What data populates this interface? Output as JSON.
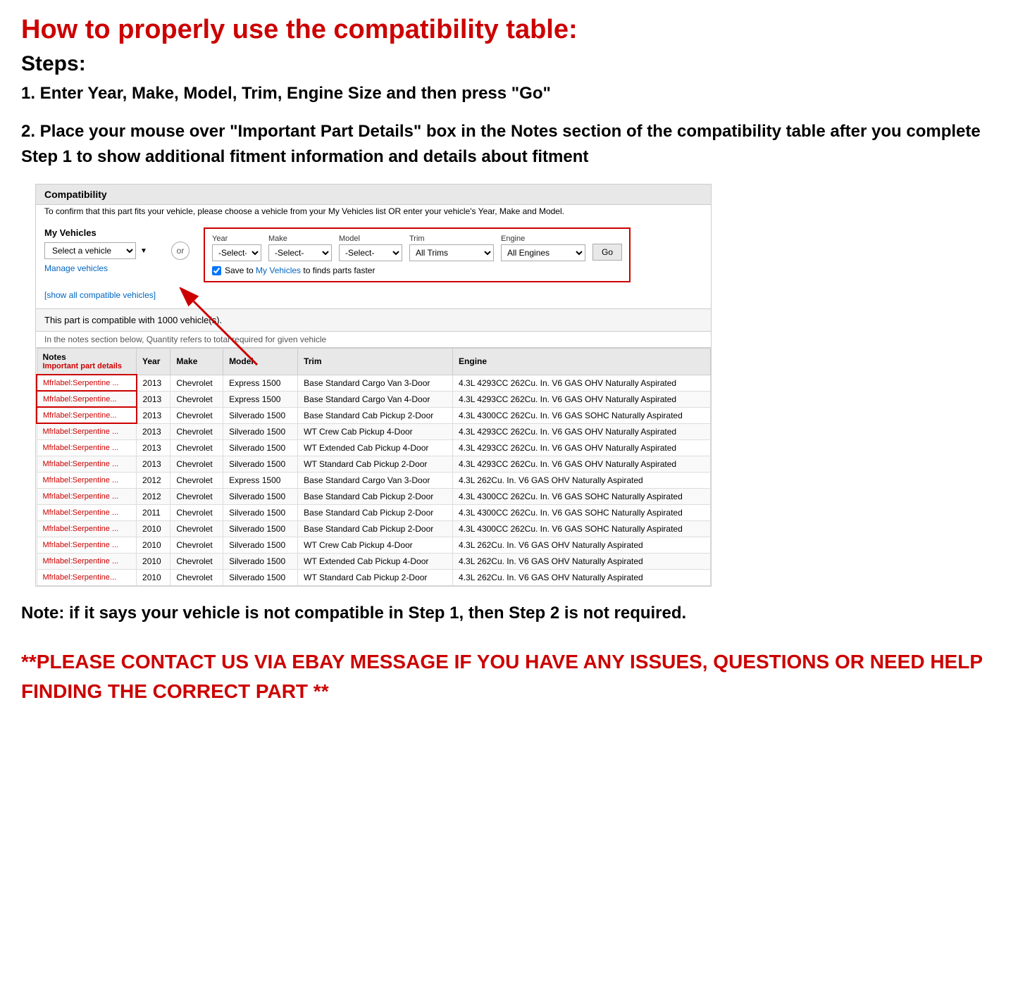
{
  "page": {
    "main_title": "How to properly use the compatibility table:",
    "steps_label": "Steps:",
    "step1": "1. Enter Year, Make, Model, Trim, Engine Size and then press \"Go\"",
    "step2": "2. Place your mouse over \"Important Part Details\" box in the Notes section of the compatibility table after you complete Step 1 to show additional fitment information and details about fitment",
    "note_text": "Note: if it says your vehicle is not compatible in Step 1, then Step 2 is not required.",
    "contact_text": "**PLEASE CONTACT US VIA EBAY MESSAGE IF YOU HAVE ANY ISSUES, QUESTIONS OR NEED HELP FINDING THE CORRECT PART **"
  },
  "compatibility": {
    "header": "Compatibility",
    "subtext": "To confirm that this part fits your vehicle, please choose a vehicle from your My Vehicles list OR enter your vehicle's Year, Make and Model.",
    "my_vehicles_label": "My Vehicles",
    "select_vehicle_placeholder": "Select a vehicle",
    "manage_vehicles": "Manage vehicles",
    "show_all": "[show all compatible vehicles]",
    "or_label": "or",
    "year_label": "Year",
    "make_label": "Make",
    "model_label": "Model",
    "trim_label": "Trim",
    "engine_label": "Engine",
    "year_placeholder": "-Select-",
    "make_placeholder": "-Select-",
    "model_placeholder": "-Select-",
    "trim_placeholder": "All Trims",
    "engine_placeholder": "All Engines",
    "go_label": "Go",
    "save_text": "Save to My Vehicles to finds parts faster",
    "compatible_count": "This part is compatible with 1000 vehicle(s).",
    "notes_bar": "In the notes section below, Quantity refers to total required for given vehicle",
    "table_headers": [
      "Notes",
      "Year",
      "Make",
      "Model",
      "Trim",
      "Engine"
    ],
    "notes_subheader": "Important part details",
    "table_rows": [
      {
        "notes": "Mfrlabel:Serpentine ...",
        "year": "2013",
        "make": "Chevrolet",
        "model": "Express 1500",
        "trim": "Base Standard Cargo Van 3-Door",
        "engine": "4.3L 4293CC 262Cu. In. V6 GAS OHV Naturally Aspirated",
        "highlight": true
      },
      {
        "notes": "Mfrlabel:Serpentine...",
        "year": "2013",
        "make": "Chevrolet",
        "model": "Express 1500",
        "trim": "Base Standard Cargo Van 4-Door",
        "engine": "4.3L 4293CC 262Cu. In. V6 GAS OHV Naturally Aspirated",
        "highlight": true
      },
      {
        "notes": "Mfrlabel:Serpentine...",
        "year": "2013",
        "make": "Chevrolet",
        "model": "Silverado 1500",
        "trim": "Base Standard Cab Pickup 2-Door",
        "engine": "4.3L 4300CC 262Cu. In. V6 GAS SOHC Naturally Aspirated",
        "highlight": true
      },
      {
        "notes": "Mfrlabel:Serpentine ...",
        "year": "2013",
        "make": "Chevrolet",
        "model": "Silverado 1500",
        "trim": "WT Crew Cab Pickup 4-Door",
        "engine": "4.3L 4293CC 262Cu. In. V6 GAS OHV Naturally Aspirated",
        "highlight": false
      },
      {
        "notes": "Mfrlabel:Serpentine ...",
        "year": "2013",
        "make": "Chevrolet",
        "model": "Silverado 1500",
        "trim": "WT Extended Cab Pickup 4-Door",
        "engine": "4.3L 4293CC 262Cu. In. V6 GAS OHV Naturally Aspirated",
        "highlight": false
      },
      {
        "notes": "Mfrlabel:Serpentine ...",
        "year": "2013",
        "make": "Chevrolet",
        "model": "Silverado 1500",
        "trim": "WT Standard Cab Pickup 2-Door",
        "engine": "4.3L 4293CC 262Cu. In. V6 GAS OHV Naturally Aspirated",
        "highlight": false
      },
      {
        "notes": "Mfrlabel:Serpentine ...",
        "year": "2012",
        "make": "Chevrolet",
        "model": "Express 1500",
        "trim": "Base Standard Cargo Van 3-Door",
        "engine": "4.3L 262Cu. In. V6 GAS OHV Naturally Aspirated",
        "highlight": false
      },
      {
        "notes": "Mfrlabel:Serpentine ...",
        "year": "2012",
        "make": "Chevrolet",
        "model": "Silverado 1500",
        "trim": "Base Standard Cab Pickup 2-Door",
        "engine": "4.3L 4300CC 262Cu. In. V6 GAS SOHC Naturally Aspirated",
        "highlight": false
      },
      {
        "notes": "Mfrlabel:Serpentine ...",
        "year": "2011",
        "make": "Chevrolet",
        "model": "Silverado 1500",
        "trim": "Base Standard Cab Pickup 2-Door",
        "engine": "4.3L 4300CC 262Cu. In. V6 GAS SOHC Naturally Aspirated",
        "highlight": false
      },
      {
        "notes": "Mfrlabel:Serpentine ...",
        "year": "2010",
        "make": "Chevrolet",
        "model": "Silverado 1500",
        "trim": "Base Standard Cab Pickup 2-Door",
        "engine": "4.3L 4300CC 262Cu. In. V6 GAS SOHC Naturally Aspirated",
        "highlight": false
      },
      {
        "notes": "Mfrlabel:Serpentine ...",
        "year": "2010",
        "make": "Chevrolet",
        "model": "Silverado 1500",
        "trim": "WT Crew Cab Pickup 4-Door",
        "engine": "4.3L 262Cu. In. V6 GAS OHV Naturally Aspirated",
        "highlight": false
      },
      {
        "notes": "Mfrlabel:Serpentine ...",
        "year": "2010",
        "make": "Chevrolet",
        "model": "Silverado 1500",
        "trim": "WT Extended Cab Pickup 4-Door",
        "engine": "4.3L 262Cu. In. V6 GAS OHV Naturally Aspirated",
        "highlight": false
      },
      {
        "notes": "Mfrlabel:Serpentine...",
        "year": "2010",
        "make": "Chevrolet",
        "model": "Silverado 1500",
        "trim": "WT Standard Cab Pickup 2-Door",
        "engine": "4.3L 262Cu. In. V6 GAS OHV Naturally Aspirated",
        "highlight": false
      }
    ]
  }
}
